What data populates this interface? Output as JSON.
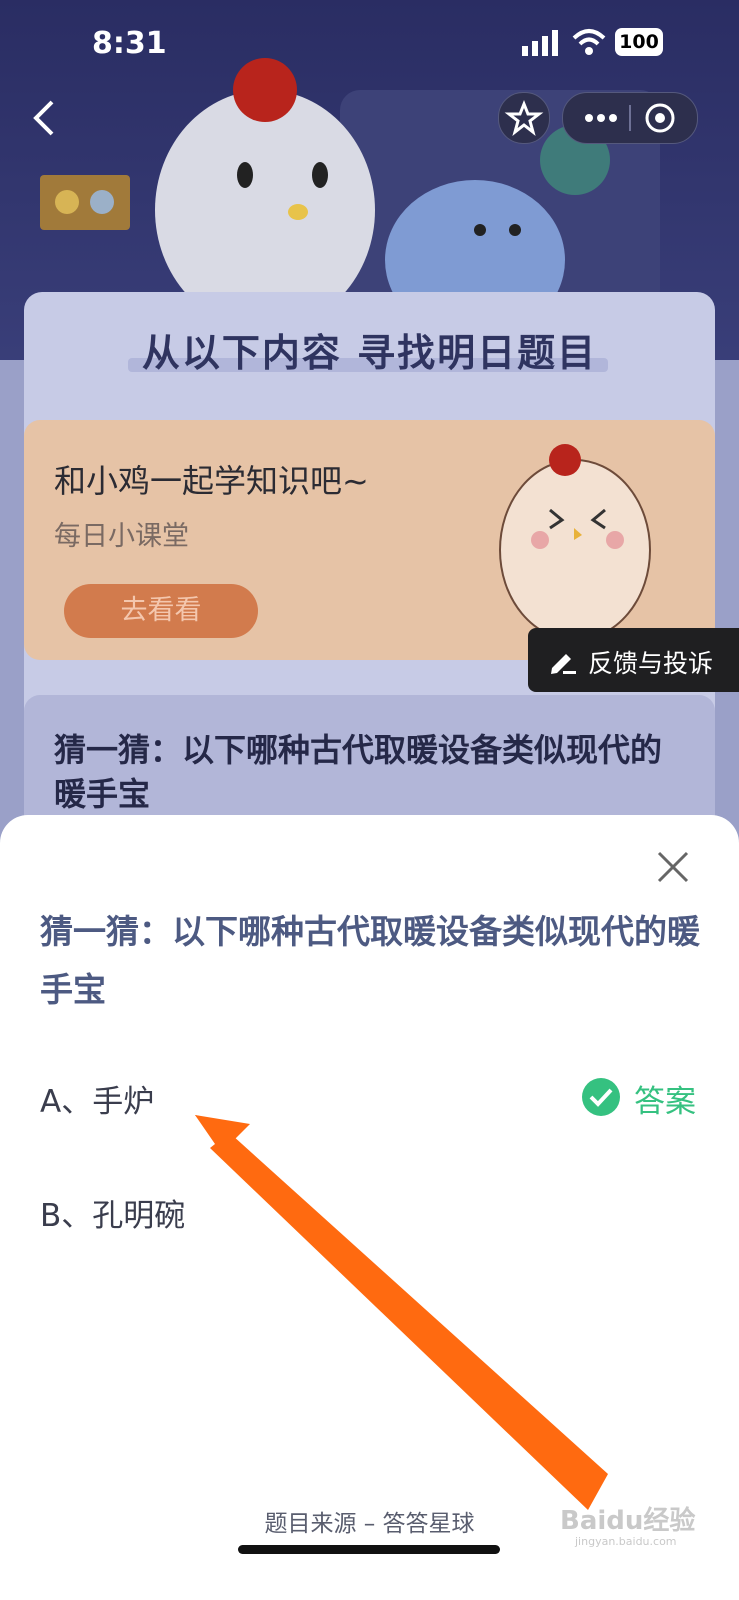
{
  "status_bar": {
    "time": "8:31",
    "battery": "100"
  },
  "nav": {
    "back_icon": "chevron-left-icon",
    "star_icon": "star-icon",
    "more_icon": "more-dots-icon",
    "target_icon": "target-icon"
  },
  "banner": {
    "headline": "从以下内容 寻找明日题目"
  },
  "lesson": {
    "title": "和小鸡一起学知识吧~",
    "subtitle": "每日小课堂",
    "button": "去看看"
  },
  "feedback": {
    "label": "反馈与投诉"
  },
  "question_card": {
    "text": "猜一猜：以下哪种古代取暖设备类似现代的暖手宝"
  },
  "sheet": {
    "question": "猜一猜：以下哪种古代取暖设备类似现代的暖手宝",
    "options": [
      {
        "label": "A、手炉",
        "is_answer": true
      },
      {
        "label": "B、孔明碗",
        "is_answer": false
      }
    ],
    "answer_label": "答案",
    "footer": "题目来源 – 答答星球"
  },
  "watermark": {
    "text": "Baidu经验",
    "sub": "jingyan.baidu.com"
  },
  "colors": {
    "answer_green": "#35c180",
    "question_blue": "#4d5a82",
    "arrow_orange": "#ff6a10"
  }
}
